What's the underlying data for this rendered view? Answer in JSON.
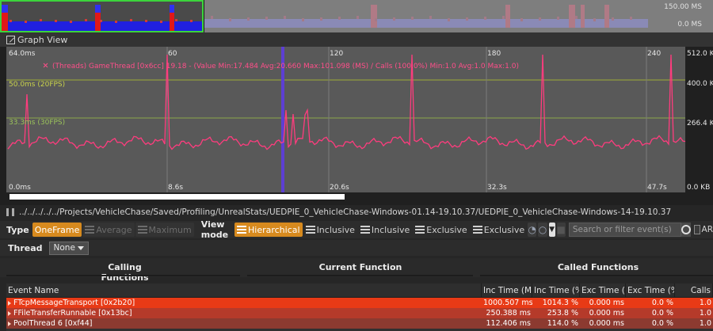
{
  "mini": {
    "top_label": "150.00 MS",
    "bottom_label": "0.0 MS"
  },
  "graph_view": {
    "title": "Graph View"
  },
  "graph": {
    "y_left_top": "64.0ms",
    "y_left_bottom": "0.0ms",
    "y_right": [
      "512.0 KB",
      "400.0 KB",
      "266.4 KB",
      "0.0 KB"
    ],
    "frame_markers": [
      "60",
      "120",
      "180",
      "240"
    ],
    "time_markers": [
      "8.6s",
      "20.6s",
      "32.3s",
      "47.7s"
    ],
    "line_50": "50.0ms (20FPS)",
    "line_33": "33.3ms (30FPS)",
    "info": "(Threads) GameThread [0x6cc] 19.18 - (Value Min:17.484 Avg:20.660 Max:101.098 (MS) / Calls (100.0%) Min:1.0 Avg:1.0 Max:1.0)",
    "series_color": "#ff3c7e",
    "selection_color": "#5d3fd3"
  },
  "path": "../../../../../Projects/VehicleChase/Saved/Profiling/UnrealStats/UEDPIE_0_VehicleChase-Windows-01.14-19.10.37/UEDPIE_0_VehicleChase-Windows-14-19.10.37",
  "toolbar": {
    "type_label": "Type",
    "one_frame": "OneFrame",
    "average": "Average",
    "maximum": "Maximum",
    "view_mode_label": "View mode",
    "hierarchical": "Hierarchical",
    "inclusive1": "Inclusive",
    "inclusive2": "Inclusive",
    "exclusive1": "Exclusive",
    "exclusive2": "Exclusive",
    "search_placeholder": "Search or filter event(s)",
    "ar_label": "AR"
  },
  "thread": {
    "label": "Thread",
    "value": "None"
  },
  "sections": {
    "calling": "Calling Functions",
    "current": "Current Function",
    "called": "Called Functions"
  },
  "table": {
    "columns": [
      "Event Name",
      "Inc Time (MS)",
      "Inc Time (%)",
      "Exc Time (MS)",
      "Exc Time (%)",
      "Calls"
    ],
    "rows": [
      {
        "name": "FTcpMessageTransport [0x2b20]",
        "inc_ms": "1000.507 ms",
        "inc_pct": "1014.3 %",
        "exc_ms": "0.000 ms",
        "exc_pct": "0.0 %",
        "calls": "1.0",
        "color": "#e83a16"
      },
      {
        "name": "FFileTransferRunnable [0x13bc]",
        "inc_ms": "250.388 ms",
        "inc_pct": "253.8 %",
        "exc_ms": "0.000 ms",
        "exc_pct": "0.0 %",
        "calls": "1.0",
        "color": "#b53a2a"
      },
      {
        "name": "PoolThread 6 [0xf44]",
        "inc_ms": "112.406 ms",
        "inc_pct": "114.0 %",
        "exc_ms": "0.000 ms",
        "exc_pct": "0.0 %",
        "calls": "1.0",
        "color": "#8c3a30"
      }
    ]
  }
}
